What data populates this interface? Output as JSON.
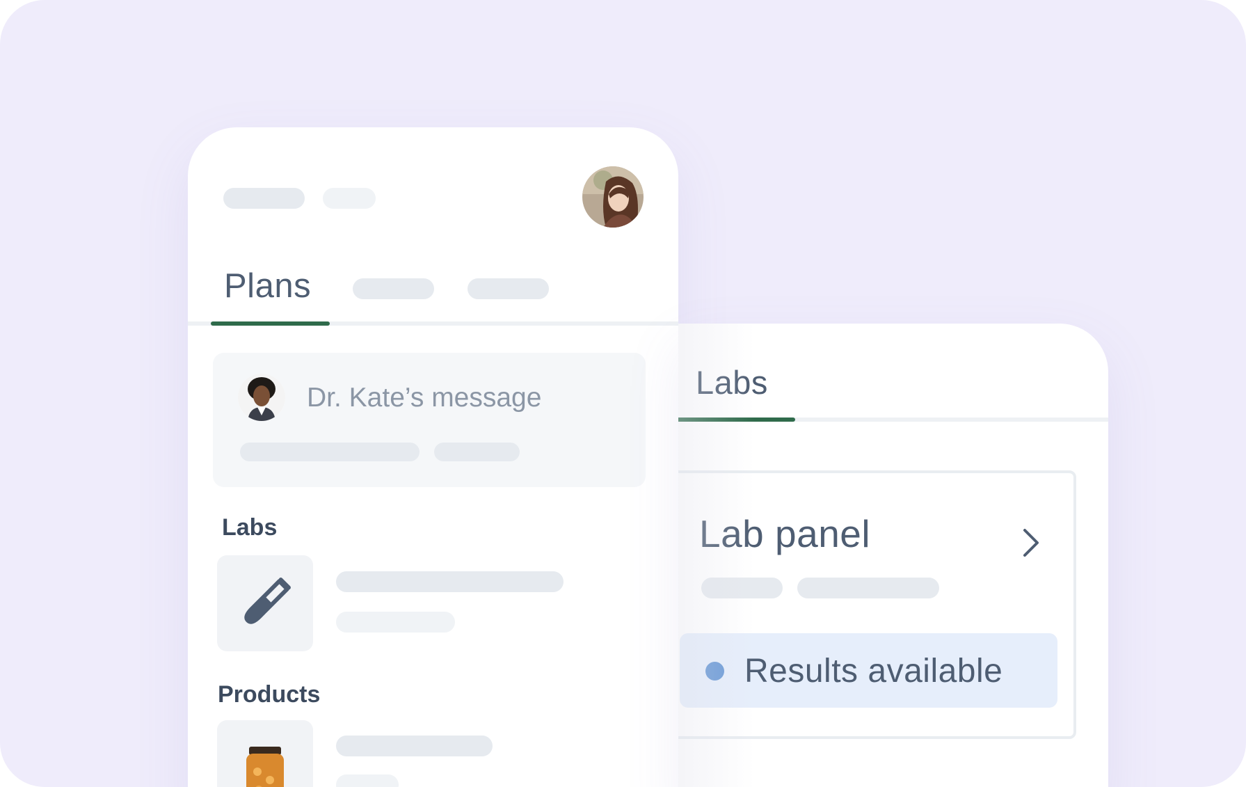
{
  "left_screen": {
    "tabs": {
      "active_label": "Plans"
    },
    "message_card": {
      "title": "Dr. Kate’s message"
    },
    "sections": {
      "labs": "Labs",
      "products": "Products"
    },
    "icons": {
      "user_avatar": "user-avatar-photo",
      "doctor_avatar": "doctor-avatar-photo",
      "lab_icon": "test-tube-icon",
      "product_icon": "supplement-bottle-icon"
    }
  },
  "right_screen": {
    "tabs": {
      "active_label": "Labs"
    },
    "lab_panel": {
      "title": "Lab panel",
      "chevron_icon": "chevron-right-icon",
      "status": "Results available",
      "status_dot_color": "#6b9ad6"
    }
  },
  "colors": {
    "background": "#efecfb",
    "accent_green": "#2f6b4b",
    "text_primary": "#4e5d72",
    "badge_bg": "#e6eefb"
  }
}
